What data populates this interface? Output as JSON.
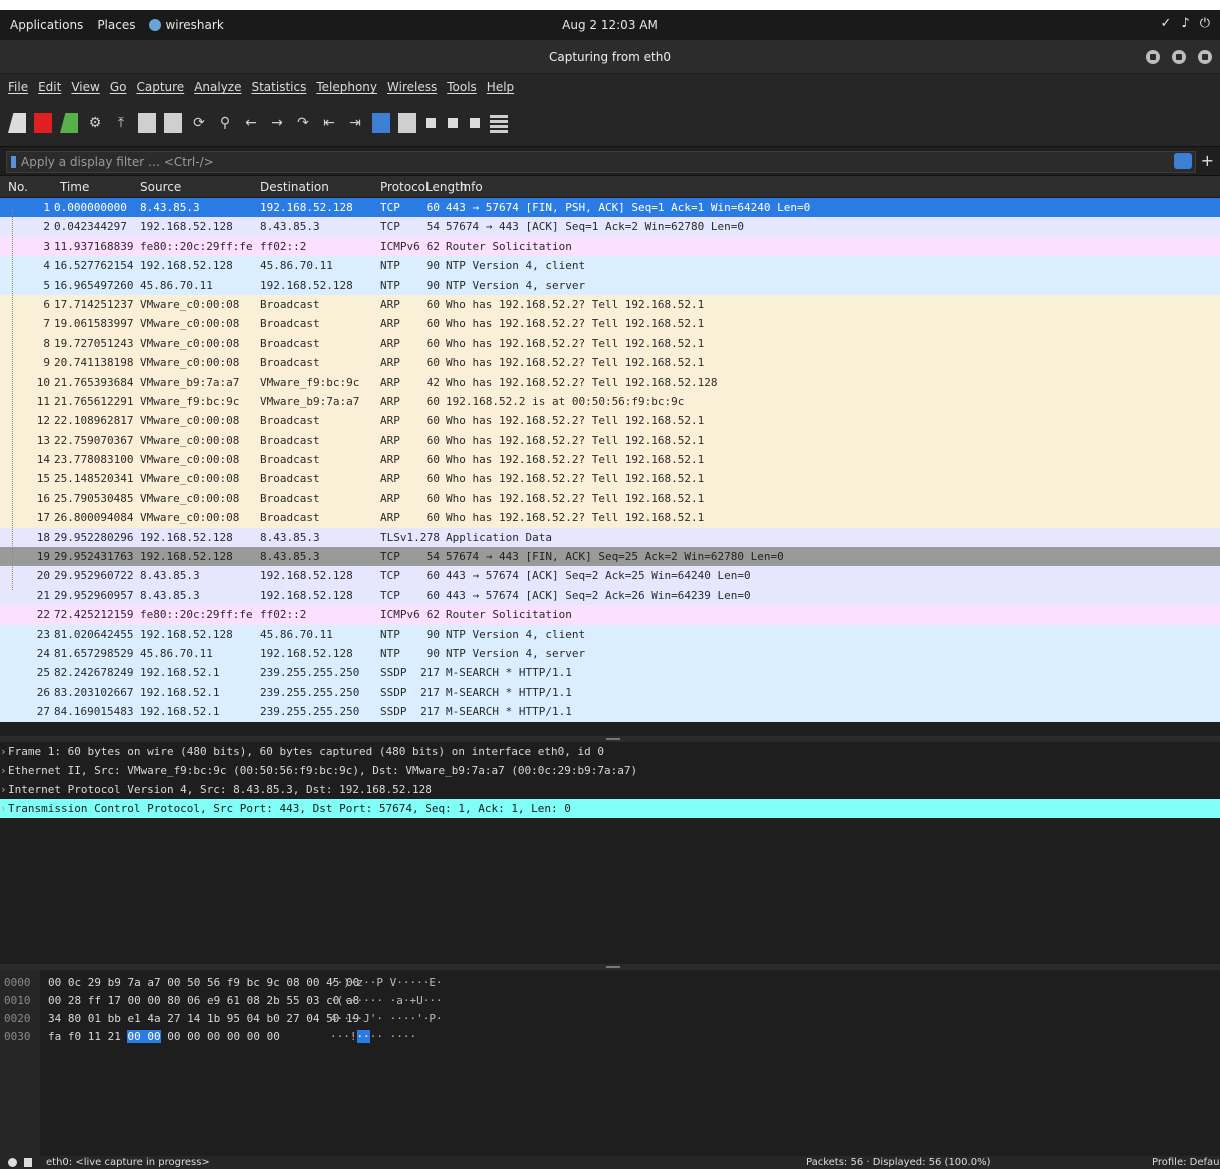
{
  "colors": {
    "selected": "#2a7be4",
    "tcp": "#e7e6ff",
    "icmpv6": "#fce0ff",
    "udp": "#daeeff",
    "arp": "#faf0d7",
    "tls": "#e7e6ff",
    "marked": "#9a9a9a",
    "highlight_detail": "#7ffff7"
  },
  "topbar": {
    "applications": "Applications",
    "places": "Places",
    "app_name": "wireshark",
    "clock": "Aug 2 12:03 AM",
    "tray": [
      "✓",
      "♪",
      "⏻"
    ]
  },
  "window": {
    "title": "Capturing from eth0"
  },
  "menu": [
    "File",
    "Edit",
    "View",
    "Go",
    "Capture",
    "Analyze",
    "Statistics",
    "Telephony",
    "Wireless",
    "Tools",
    "Help"
  ],
  "filter": {
    "placeholder": "Apply a display filter … <Ctrl-/>",
    "plus": "+"
  },
  "columns": {
    "no": "No.",
    "time": "Time",
    "source": "Source",
    "destination": "Destination",
    "protocol": "Protocol",
    "length": "Length",
    "info": "Info"
  },
  "packets": [
    {
      "no": "1",
      "time": "0.000000000",
      "src": "8.43.85.3",
      "dst": "192.168.52.128",
      "proto": "TCP",
      "len": "60",
      "info": "443 → 57674 [FIN, PSH, ACK] Seq=1 Ack=1 Win=64240 Len=0",
      "color": "#2a7be4"
    },
    {
      "no": "2",
      "time": "0.042344297",
      "src": "192.168.52.128",
      "dst": "8.43.85.3",
      "proto": "TCP",
      "len": "54",
      "info": "57674 → 443 [ACK] Seq=1 Ack=2 Win=62780 Len=0",
      "color": "#e7e6ff"
    },
    {
      "no": "3",
      "time": "11.937168839",
      "src": "fe80::20c:29ff:feb9…",
      "dst": "ff02::2",
      "proto": "ICMPv6",
      "len": "62",
      "info": "Router Solicitation",
      "color": "#fce0ff"
    },
    {
      "no": "4",
      "time": "16.527762154",
      "src": "192.168.52.128",
      "dst": "45.86.70.11",
      "proto": "NTP",
      "len": "90",
      "info": "NTP Version 4, client",
      "color": "#daeeff"
    },
    {
      "no": "5",
      "time": "16.965497260",
      "src": "45.86.70.11",
      "dst": "192.168.52.128",
      "proto": "NTP",
      "len": "90",
      "info": "NTP Version 4, server",
      "color": "#daeeff"
    },
    {
      "no": "6",
      "time": "17.714251237",
      "src": "VMware_c0:00:08",
      "dst": "Broadcast",
      "proto": "ARP",
      "len": "60",
      "info": "Who has 192.168.52.2? Tell 192.168.52.1",
      "color": "#faf0d7"
    },
    {
      "no": "7",
      "time": "19.061583997",
      "src": "VMware_c0:00:08",
      "dst": "Broadcast",
      "proto": "ARP",
      "len": "60",
      "info": "Who has 192.168.52.2? Tell 192.168.52.1",
      "color": "#faf0d7"
    },
    {
      "no": "8",
      "time": "19.727051243",
      "src": "VMware_c0:00:08",
      "dst": "Broadcast",
      "proto": "ARP",
      "len": "60",
      "info": "Who has 192.168.52.2? Tell 192.168.52.1",
      "color": "#faf0d7"
    },
    {
      "no": "9",
      "time": "20.741138198",
      "src": "VMware_c0:00:08",
      "dst": "Broadcast",
      "proto": "ARP",
      "len": "60",
      "info": "Who has 192.168.52.2? Tell 192.168.52.1",
      "color": "#faf0d7"
    },
    {
      "no": "10",
      "time": "21.765393684",
      "src": "VMware_b9:7a:a7",
      "dst": "VMware_f9:bc:9c",
      "proto": "ARP",
      "len": "42",
      "info": "Who has 192.168.52.2? Tell 192.168.52.128",
      "color": "#faf0d7"
    },
    {
      "no": "11",
      "time": "21.765612291",
      "src": "VMware_f9:bc:9c",
      "dst": "VMware_b9:7a:a7",
      "proto": "ARP",
      "len": "60",
      "info": "192.168.52.2 is at 00:50:56:f9:bc:9c",
      "color": "#faf0d7"
    },
    {
      "no": "12",
      "time": "22.108962817",
      "src": "VMware_c0:00:08",
      "dst": "Broadcast",
      "proto": "ARP",
      "len": "60",
      "info": "Who has 192.168.52.2? Tell 192.168.52.1",
      "color": "#faf0d7"
    },
    {
      "no": "13",
      "time": "22.759070367",
      "src": "VMware_c0:00:08",
      "dst": "Broadcast",
      "proto": "ARP",
      "len": "60",
      "info": "Who has 192.168.52.2? Tell 192.168.52.1",
      "color": "#faf0d7"
    },
    {
      "no": "14",
      "time": "23.778083100",
      "src": "VMware_c0:00:08",
      "dst": "Broadcast",
      "proto": "ARP",
      "len": "60",
      "info": "Who has 192.168.52.2? Tell 192.168.52.1",
      "color": "#faf0d7"
    },
    {
      "no": "15",
      "time": "25.148520341",
      "src": "VMware_c0:00:08",
      "dst": "Broadcast",
      "proto": "ARP",
      "len": "60",
      "info": "Who has 192.168.52.2? Tell 192.168.52.1",
      "color": "#faf0d7"
    },
    {
      "no": "16",
      "time": "25.790530485",
      "src": "VMware_c0:00:08",
      "dst": "Broadcast",
      "proto": "ARP",
      "len": "60",
      "info": "Who has 192.168.52.2? Tell 192.168.52.1",
      "color": "#faf0d7"
    },
    {
      "no": "17",
      "time": "26.800094084",
      "src": "VMware_c0:00:08",
      "dst": "Broadcast",
      "proto": "ARP",
      "len": "60",
      "info": "Who has 192.168.52.2? Tell 192.168.52.1",
      "color": "#faf0d7"
    },
    {
      "no": "18",
      "time": "29.952280296",
      "src": "192.168.52.128",
      "dst": "8.43.85.3",
      "proto": "TLSv1.2",
      "len": "78",
      "info": "Application Data",
      "color": "#e7e6ff"
    },
    {
      "no": "19",
      "time": "29.952431763",
      "src": "192.168.52.128",
      "dst": "8.43.85.3",
      "proto": "TCP",
      "len": "54",
      "info": "57674 → 443 [FIN, ACK] Seq=25 Ack=2 Win=62780 Len=0",
      "color": "#9a9a9a"
    },
    {
      "no": "20",
      "time": "29.952960722",
      "src": "8.43.85.3",
      "dst": "192.168.52.128",
      "proto": "TCP",
      "len": "60",
      "info": "443 → 57674 [ACK] Seq=2 Ack=25 Win=64240 Len=0",
      "color": "#e7e6ff"
    },
    {
      "no": "21",
      "time": "29.952960957",
      "src": "8.43.85.3",
      "dst": "192.168.52.128",
      "proto": "TCP",
      "len": "60",
      "info": "443 → 57674 [ACK] Seq=2 Ack=26 Win=64239 Len=0",
      "color": "#e7e6ff"
    },
    {
      "no": "22",
      "time": "72.425212159",
      "src": "fe80::20c:29ff:feb9…",
      "dst": "ff02::2",
      "proto": "ICMPv6",
      "len": "62",
      "info": "Router Solicitation",
      "color": "#fce0ff"
    },
    {
      "no": "23",
      "time": "81.020642455",
      "src": "192.168.52.128",
      "dst": "45.86.70.11",
      "proto": "NTP",
      "len": "90",
      "info": "NTP Version 4, client",
      "color": "#daeeff"
    },
    {
      "no": "24",
      "time": "81.657298529",
      "src": "45.86.70.11",
      "dst": "192.168.52.128",
      "proto": "NTP",
      "len": "90",
      "info": "NTP Version 4, server",
      "color": "#daeeff"
    },
    {
      "no": "25",
      "time": "82.242678249",
      "src": "192.168.52.1",
      "dst": "239.255.255.250",
      "proto": "SSDP",
      "len": "217",
      "info": "M-SEARCH * HTTP/1.1",
      "color": "#daeeff"
    },
    {
      "no": "26",
      "time": "83.203102667",
      "src": "192.168.52.1",
      "dst": "239.255.255.250",
      "proto": "SSDP",
      "len": "217",
      "info": "M-SEARCH * HTTP/1.1",
      "color": "#daeeff"
    },
    {
      "no": "27",
      "time": "84.169015483",
      "src": "192.168.52.1",
      "dst": "239.255.255.250",
      "proto": "SSDP",
      "len": "217",
      "info": "M-SEARCH * HTTP/1.1",
      "color": "#daeeff"
    }
  ],
  "details": [
    "Frame 1: 60 bytes on wire (480 bits), 60 bytes captured (480 bits) on interface eth0, id 0",
    "Ethernet II, Src: VMware_f9:bc:9c (00:50:56:f9:bc:9c), Dst: VMware_b9:7a:a7 (00:0c:29:b9:7a:a7)",
    "Internet Protocol Version 4, Src: 8.43.85.3, Dst: 192.168.52.128",
    "Transmission Control Protocol, Src Port: 443, Dst Port: 57674, Seq: 1, Ack: 1, Len: 0"
  ],
  "bytes": [
    {
      "off": "0000",
      "hex": "00 0c 29 b9 7a a7 00 50  56 f9 bc 9c 08 00 45 00",
      "ascii": "··)·z··P V·····E·"
    },
    {
      "off": "0010",
      "hex": "00 28 ff 17 00 00 80 06  e9 61 08 2b 55 03 c0 a8",
      "ascii": "·(······ ·a·+U···"
    },
    {
      "off": "0020",
      "hex": "34 80 01 bb e1 4a 27 14  1b 95 04 b0 27 04 50 19",
      "ascii": "4····J'· ····'·P·"
    },
    {
      "off": "0030",
      "hex_pre": "fa f0 11 21 ",
      "hex_hl": "00 00",
      "hex_post": " 00 00  00 00 00 00",
      "ascii_pre": "···!",
      "ascii_hl": "··",
      "ascii_post": "·· ····"
    }
  ],
  "status": {
    "iface": "eth0: <live capture in progress>",
    "packets": "Packets: 56 · Displayed: 56 (100.0%)",
    "profile": "Profile: Default"
  }
}
